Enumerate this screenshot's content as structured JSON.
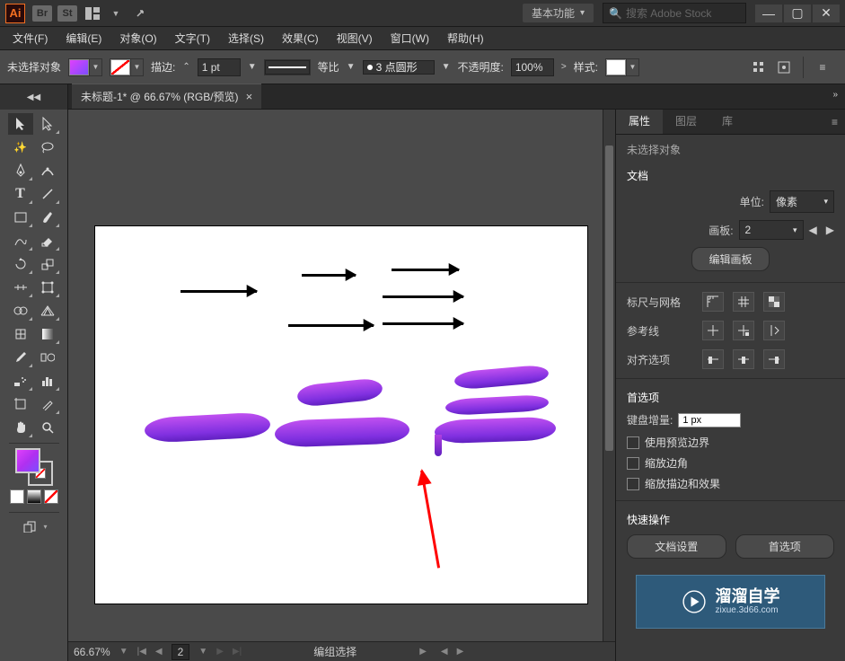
{
  "workspace": "基本功能",
  "search_placeholder": "搜索 Adobe Stock",
  "menubar": [
    "文件(F)",
    "编辑(E)",
    "对象(O)",
    "文字(T)",
    "选择(S)",
    "效果(C)",
    "视图(V)",
    "窗口(W)",
    "帮助(H)"
  ],
  "options": {
    "selection_label": "未选择对象",
    "stroke_label": "描边:",
    "stroke_weight": "1 pt",
    "profile_label": "等比",
    "brush_label": "3 点圆形",
    "opacity_label": "不透明度:",
    "opacity_value": "100%",
    "style_label": "样式:"
  },
  "document": {
    "tab_title": "未标题-1* @ 66.67% (RGB/预览)",
    "zoom": "66.67%",
    "artboard_page": "2",
    "status_tool": "编组选择"
  },
  "panels": {
    "tabs": [
      "属性",
      "图层",
      "库"
    ],
    "no_selection": "未选择对象",
    "doc_section": "文档",
    "units_label": "单位:",
    "units_value": "像素",
    "artboard_label": "画板:",
    "artboard_value": "2",
    "edit_artboard_btn": "编辑画板",
    "rulers_grid": "标尺与网格",
    "guides": "参考线",
    "align_options": "对齐选项",
    "preferences": "首选项",
    "keyboard_inc_label": "键盘增量:",
    "keyboard_inc_value": "1 px",
    "use_preview_bounds": "使用预览边界",
    "scale_corners": "缩放边角",
    "scale_stroke_effects": "缩放描边和效果",
    "quick_actions": "快速操作",
    "doc_setup_btn": "文档设置",
    "prefs_btn": "首选项"
  },
  "watermark": {
    "brand": "溜溜自学",
    "url": "zixue.3d66.com"
  }
}
